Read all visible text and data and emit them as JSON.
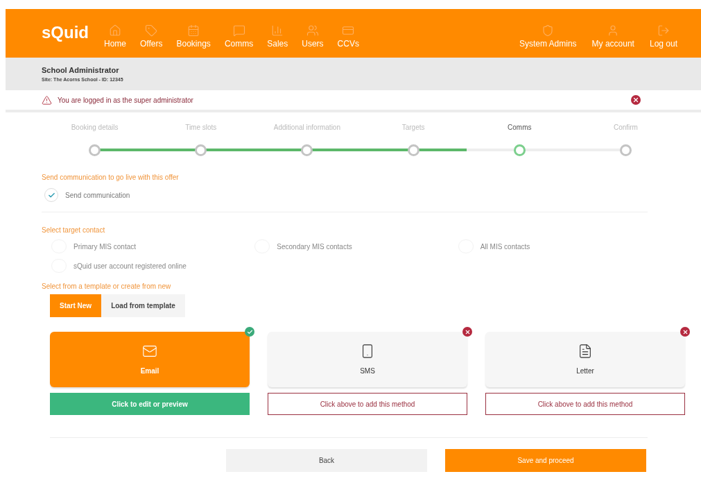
{
  "header": {
    "logo": "sQuid",
    "nav": [
      {
        "label": "Home"
      },
      {
        "label": "Offers"
      },
      {
        "label": "Bookings"
      },
      {
        "label": "Comms"
      },
      {
        "label": "Sales"
      },
      {
        "label": "Users"
      },
      {
        "label": "CCVs"
      }
    ],
    "right_nav": [
      {
        "label": "System Admins"
      },
      {
        "label": "My account"
      },
      {
        "label": "Log out"
      }
    ]
  },
  "user_bar": {
    "role": "School Administrator",
    "site": "Site: The Acorns School - ID: 12345"
  },
  "alert": {
    "message": "You are logged in as the super administrator"
  },
  "steps": [
    {
      "label": "Booking details",
      "completed": true,
      "selected": false
    },
    {
      "label": "Time slots",
      "completed": true,
      "selected": false
    },
    {
      "label": "Additional information",
      "completed": true,
      "selected": false
    },
    {
      "label": "Targets",
      "completed": true,
      "selected": false
    },
    {
      "label": "Comms",
      "completed": false,
      "selected": true
    },
    {
      "label": "Confirm",
      "completed": false,
      "selected": false
    }
  ],
  "go_live": {
    "heading": "Send communication to go live with this offer",
    "label": "Send communication",
    "checked": true
  },
  "target_contact": {
    "heading": "Select target contact",
    "options": [
      {
        "label": "Primary MIS contact",
        "selected": false
      },
      {
        "label": "Secondary MIS contacts",
        "selected": false
      },
      {
        "label": "All MIS contacts",
        "selected": false
      },
      {
        "label": "sQuid user account registered online",
        "selected": false
      }
    ]
  },
  "template": {
    "heading": "Select from a template or create from new",
    "options": [
      {
        "label": "Start New",
        "selected": true
      },
      {
        "label": "Load from template",
        "selected": false
      }
    ]
  },
  "methods": [
    {
      "label": "Email",
      "selected": true,
      "action": "Click to edit or preview"
    },
    {
      "label": "SMS",
      "selected": false,
      "action": "Click above to add this method"
    },
    {
      "label": "Letter",
      "selected": false,
      "action": "Click above to add this method"
    }
  ],
  "footer_buttons": [
    {
      "label": "Back",
      "kind": "secondary"
    },
    {
      "label": "Save and proceed",
      "kind": "primary"
    }
  ]
}
